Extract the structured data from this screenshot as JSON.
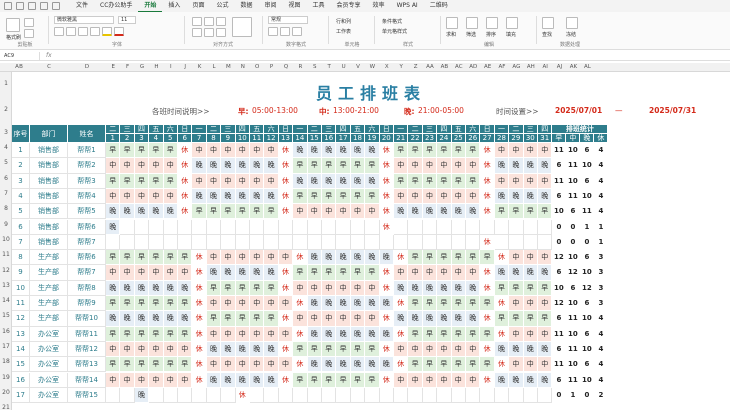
{
  "menubar": {
    "tabs": [
      "文件",
      "CC办公助手",
      "开始",
      "插入",
      "页面",
      "公式",
      "数据",
      "审阅",
      "视图",
      "工具",
      "会员专享",
      "效率",
      "WPS AI",
      "二维码"
    ],
    "active": 2
  },
  "ribbon": {
    "font_name": "微软雅黑",
    "font_size": "11",
    "groups": [
      "剪贴板",
      "字体",
      "对齐方式",
      "数字格式",
      "单元格",
      "样式",
      "编辑",
      "数据处理"
    ],
    "labels": [
      "格式刷",
      "粘贴",
      "常规",
      "行和列",
      "工作表",
      "条件格式",
      "单元格样式",
      "求和",
      "筛选",
      "排序",
      "填充",
      "查找",
      "冻结"
    ]
  },
  "formula_bar": {
    "name_box": "AC9",
    "fx": "fx"
  },
  "col_letters": [
    "A",
    "B",
    "C",
    "D",
    "E",
    "F",
    "G",
    "H",
    "I",
    "J",
    "K",
    "L",
    "M",
    "N",
    "O",
    "P",
    "Q",
    "R",
    "S",
    "T",
    "U",
    "V",
    "W",
    "X",
    "Y",
    "Z",
    "AA",
    "AB",
    "AC",
    "AD",
    "AE",
    "AF",
    "AG",
    "AH",
    "AI",
    "AJ",
    "AK",
    "AL"
  ],
  "row_numbers": [
    "1",
    "2",
    "3",
    "4",
    "5",
    "6",
    "7",
    "8",
    "9",
    "10",
    "11",
    "12",
    "13",
    "14",
    "15",
    "16",
    "17",
    "18",
    "19",
    "20",
    "21",
    "22",
    "23"
  ],
  "title": "员工排班表",
  "info": {
    "legend_label": "各班时间说明>>",
    "early_label": "早:",
    "early_time": "05:00-13:00",
    "mid_label": "中:",
    "mid_time": "13:00-21:00",
    "late_label": "晚:",
    "late_time": "21:00-05:00",
    "period_label": "时间设置>>",
    "start_date": "2025/07/01",
    "dash": "—",
    "end_date": "2025/07/31"
  },
  "header": {
    "seq": "序号",
    "dept": "部门",
    "name": "姓名",
    "stat_title": "排班统计",
    "stat_cols": [
      "早",
      "中",
      "晚",
      "休"
    ],
    "weekdays": [
      "二",
      "三",
      "四",
      "五",
      "六",
      "日",
      "一",
      "二",
      "三",
      "四",
      "五",
      "六",
      "日",
      "一",
      "二",
      "三",
      "四",
      "五",
      "六",
      "日",
      "一",
      "二",
      "三",
      "四",
      "五",
      "六",
      "日",
      "一",
      "二",
      "三",
      "四"
    ],
    "days": [
      "1",
      "2",
      "3",
      "4",
      "5",
      "6",
      "7",
      "8",
      "9",
      "10",
      "11",
      "12",
      "13",
      "14",
      "15",
      "16",
      "17",
      "18",
      "19",
      "20",
      "21",
      "22",
      "23",
      "24",
      "25",
      "26",
      "27",
      "28",
      "29",
      "30",
      "31"
    ]
  },
  "rows": [
    {
      "seq": "1",
      "dept": "销售部",
      "name": "帮帮1",
      "shifts": "早早早早早休中中中中中中休晚晚晚晚晚晚休早早早早早早休中中中中",
      "stats": [
        "11",
        "10",
        "6",
        "4"
      ]
    },
    {
      "seq": "2",
      "dept": "销售部",
      "name": "帮帮2",
      "shifts": "中中中中中休晚晚晚晚晚晚休早早早早早早休中中中中中中休晚晚晚晚",
      "stats": [
        "6",
        "11",
        "10",
        "4"
      ]
    },
    {
      "seq": "3",
      "dept": "销售部",
      "name": "帮帮3",
      "shifts": "早早早早早休中中中中中中休晚晚晚晚晚晚休早早早早早早休中中中中",
      "stats": [
        "11",
        "10",
        "6",
        "4"
      ]
    },
    {
      "seq": "4",
      "dept": "销售部",
      "name": "帮帮4",
      "shifts": "中中中中中休晚晚晚晚晚晚休早早早早早早休中中中中中中休晚晚晚晚",
      "stats": [
        "6",
        "11",
        "10",
        "4"
      ]
    },
    {
      "seq": "5",
      "dept": "销售部",
      "name": "帮帮5",
      "shifts": "晚晚晚晚晚休早早早早早早休中中中中中中休晚晚晚晚晚晚休早早早早",
      "stats": [
        "10",
        "6",
        "11",
        "4"
      ]
    },
    {
      "seq": "6",
      "dept": "销售部",
      "name": "帮帮6",
      "shifts": "晚                  休          ",
      "stats": [
        "0",
        "0",
        "1",
        "1"
      ]
    },
    {
      "seq": "7",
      "dept": "销售部",
      "name": "帮帮7",
      "shifts": "                          休    ",
      "stats": [
        "0",
        "0",
        "0",
        "1"
      ]
    },
    {
      "seq": "8",
      "dept": "生产部",
      "name": "帮帮6",
      "shifts": "早早早早早早休中中中中中中休晚晚晚晚晚晚休早早早早早早休中中中中",
      "stats": [
        "12",
        "10",
        "6",
        "3"
      ]
    },
    {
      "seq": "9",
      "dept": "生产部",
      "name": "帮帮7",
      "shifts": "中中中中中中休晚晚晚晚晚休早早早早早早休中中中中中中休晚晚晚晚晚",
      "stats": [
        "6",
        "12",
        "10",
        "3"
      ]
    },
    {
      "seq": "10",
      "dept": "生产部",
      "name": "帮帮8",
      "shifts": "晚晚晚晚晚晚休早早早早早休中中中中中中休晚晚晚晚晚晚休早早早早早",
      "stats": [
        "10",
        "6",
        "12",
        "3"
      ]
    },
    {
      "seq": "11",
      "dept": "生产部",
      "name": "帮帮9",
      "shifts": "早早早早早早休中中中中中中休晚晚晚晚晚晚休早早早早早早休中中中中",
      "stats": [
        "12",
        "10",
        "6",
        "3"
      ]
    },
    {
      "seq": "12",
      "dept": "生产部",
      "name": "帮帮10",
      "shifts": "晚晚晚晚晚晚休早早早早早休中中中中中中休晚晚晚晚晚晚休早早早早早",
      "stats": [
        "6",
        "11",
        "10",
        "4"
      ]
    },
    {
      "seq": "13",
      "dept": "办公室",
      "name": "帮帮11",
      "shifts": "早早早早早早休中中中中中中休晚晚晚晚晚晚休早早早早早早休中中中中",
      "stats": [
        "11",
        "10",
        "6",
        "4"
      ]
    },
    {
      "seq": "14",
      "dept": "办公室",
      "name": "帮帮12",
      "shifts": "中中中中中中休晚晚晚晚晚休早早早早早早休中中中中中中休晚晚晚晚晚",
      "stats": [
        "6",
        "11",
        "10",
        "4"
      ]
    },
    {
      "seq": "15",
      "dept": "办公室",
      "name": "帮帮13",
      "shifts": "早早早早早早休中中中中中中休晚晚晚晚晚晚休早早早早早早休中中中中",
      "stats": [
        "11",
        "10",
        "6",
        "4"
      ]
    },
    {
      "seq": "16",
      "dept": "办公室",
      "name": "帮帮14",
      "shifts": "中中中中中中休晚晚晚晚晚休早早早早早早休中中中中中中休晚晚晚晚晚",
      "stats": [
        "6",
        "11",
        "10",
        "4"
      ]
    },
    {
      "seq": "17",
      "dept": "办公室",
      "name": "帮帮15",
      "shifts": "  晚      休                    ",
      "stats": [
        "0",
        "1",
        "0",
        "2"
      ]
    }
  ],
  "shift_colors": {
    "早": "#dff0dc",
    "中": "#fbe3dc",
    "晚": "#e6eef6",
    "休": "#ffffff"
  },
  "accent": "#2e7d8c"
}
